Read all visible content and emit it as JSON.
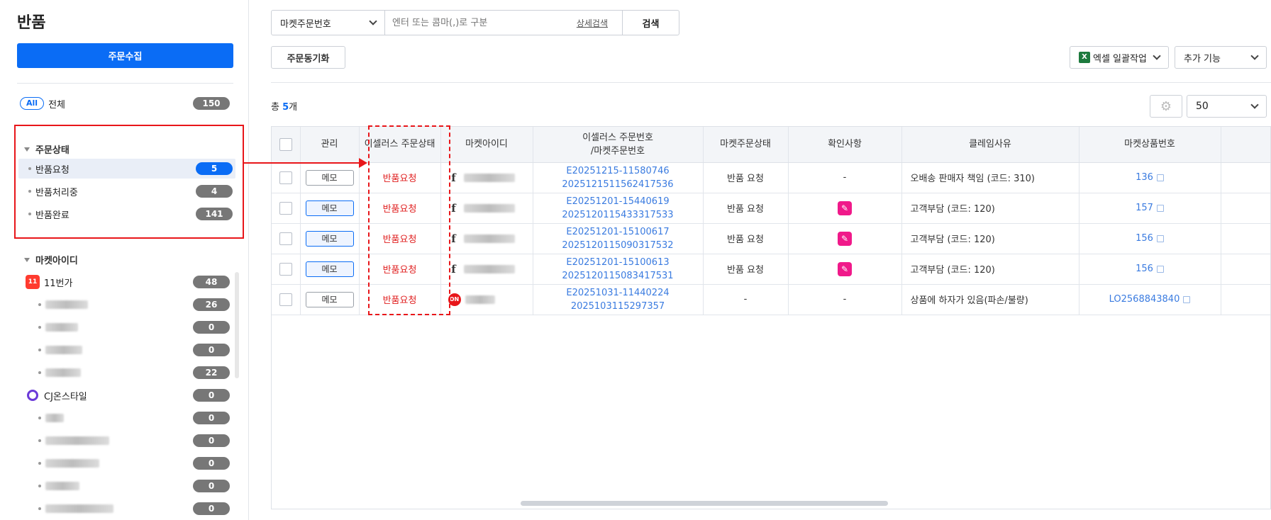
{
  "sidebar": {
    "title": "반품",
    "collect_button": "주문수집",
    "all": {
      "pill": "All",
      "label": "전체",
      "count": "150"
    },
    "status_group": {
      "title": "주문상태",
      "items": [
        {
          "label": "반품요청",
          "count": "5"
        },
        {
          "label": "반품처리중",
          "count": "4"
        },
        {
          "label": "반품완료",
          "count": "141"
        }
      ]
    },
    "market_group": {
      "title": "마켓아이디",
      "markets": [
        {
          "icon": "11st-icon",
          "label": "11번가",
          "count": "48",
          "subs": [
            "26",
            "0",
            "0",
            "22"
          ]
        },
        {
          "icon": "cj-onstyle-icon",
          "label": "CJ온스타일",
          "count": "0",
          "subs": [
            "0",
            "0",
            "0",
            "0",
            "0"
          ]
        }
      ]
    }
  },
  "toolbar": {
    "search_type": "마켓주문번호",
    "search_placeholder": "엔터 또는 콤마(,)로 구분",
    "detail_search": "상세검색",
    "search_button": "검색",
    "sync_button": "주문동기화",
    "excel_button": "엑셀 일괄작업",
    "more_button": "추가 기능",
    "total_prefix": "총 ",
    "total_count": "5",
    "total_suffix": "개",
    "page_size": "50"
  },
  "table": {
    "headers": [
      "관리",
      "이셀러스 주문상태",
      "마켓아이디",
      "이셀러스 주문번호\n/마켓주문번호",
      "마켓주문상태",
      "확인사항",
      "클레임사유",
      "마켓상품번호"
    ],
    "rows": [
      {
        "memo": "메모",
        "memo_highlight": false,
        "status": "반품요청",
        "market_icon": "f-icon",
        "order_no": "E20251215-11580746",
        "market_order_no": "2025121511562417536",
        "market_status": "반품 요청",
        "check": "-",
        "claim": "오배송 판매자 책임 (코드: 310)",
        "product_no": "136"
      },
      {
        "memo": "메모",
        "memo_highlight": true,
        "status": "반품요청",
        "market_icon": "f-icon",
        "order_no": "E20251201-15440619",
        "market_order_no": "2025120115433317533",
        "market_status": "반품 요청",
        "check": "note-icon",
        "claim": "고객부담 (코드: 120)",
        "product_no": "157"
      },
      {
        "memo": "메모",
        "memo_highlight": true,
        "status": "반품요청",
        "market_icon": "f-icon",
        "order_no": "E20251201-15100617",
        "market_order_no": "2025120115090317532",
        "market_status": "반품 요청",
        "check": "note-icon",
        "claim": "고객부담 (코드: 120)",
        "product_no": "156"
      },
      {
        "memo": "메모",
        "memo_highlight": true,
        "status": "반품요청",
        "market_icon": "f-icon",
        "order_no": "E20251201-15100613",
        "market_order_no": "2025120115083417531",
        "market_status": "반품 요청",
        "check": "note-icon",
        "claim": "고객부담 (코드: 120)",
        "product_no": "156"
      },
      {
        "memo": "메모",
        "memo_highlight": false,
        "status": "반품요청",
        "market_icon": "on-icon",
        "order_no": "E20251031-11440224",
        "market_order_no": "2025103115297357",
        "market_status": "-",
        "check": "-",
        "claim": "상품에 하자가 있음(파손/불량)",
        "product_no": "LO2568843840"
      }
    ]
  },
  "colors": {
    "accent": "#0a6cf5",
    "highlight": "#e8161a",
    "link": "#3a7be0",
    "note_icon": "#f0198a"
  }
}
